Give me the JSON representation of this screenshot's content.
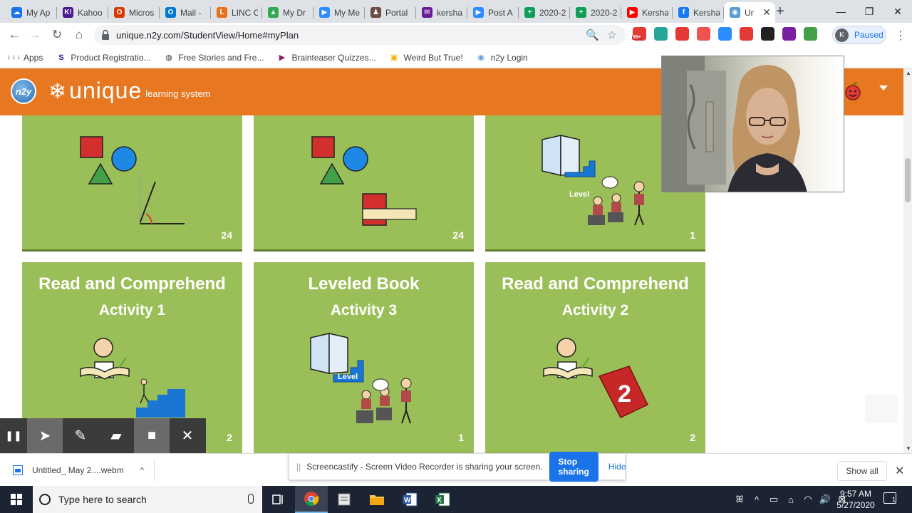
{
  "browser": {
    "tabs": [
      {
        "label": "My Ap",
        "color": "#1a73e8",
        "glyph": "☁"
      },
      {
        "label": "Kahoo",
        "color": "#46178f",
        "glyph": "K!"
      },
      {
        "label": "Micros",
        "color": "#d83b01",
        "glyph": "O"
      },
      {
        "label": "Mail -",
        "color": "#0078d4",
        "glyph": "O"
      },
      {
        "label": "LINC C",
        "color": "#e8711a",
        "glyph": "L"
      },
      {
        "label": "My Dr",
        "color": "#34a853",
        "glyph": "▲"
      },
      {
        "label": "My Me",
        "color": "#2d8cff",
        "glyph": "▶"
      },
      {
        "label": "Portal",
        "color": "#6d4c41",
        "glyph": "♟"
      },
      {
        "label": "kersha",
        "color": "#6a1b9a",
        "glyph": "✉"
      },
      {
        "label": "Post A",
        "color": "#2d8cff",
        "glyph": "▶"
      },
      {
        "label": "2020-2",
        "color": "#0f9d58",
        "glyph": "+"
      },
      {
        "label": "2020-2",
        "color": "#0f9d58",
        "glyph": "+"
      },
      {
        "label": "Kersha",
        "color": "#ff0000",
        "glyph": "▶"
      },
      {
        "label": "Kersha",
        "color": "#1877f2",
        "glyph": "f"
      },
      {
        "label": "Ur",
        "color": "#5b9bd5",
        "glyph": "◉",
        "active": true
      }
    ],
    "new_tab": "+",
    "window_controls": {
      "minimize": "—",
      "maximize": "❐",
      "close": "✕"
    },
    "nav": {
      "back": "←",
      "forward": "→",
      "reload": "↻",
      "home": "⌂"
    },
    "url": "unique.n2y.com/StudentView/Home#myPlan",
    "zoom_icon": "🔍",
    "star_icon": "☆",
    "extensions": [
      {
        "name": "ext-mail-icon",
        "color": "#e53935",
        "badge": "99+"
      },
      {
        "name": "ext-screenshot-icon",
        "color": "#26a69a"
      },
      {
        "name": "ext-record-icon",
        "color": "#e53935"
      },
      {
        "name": "ext-grammar-icon",
        "color": "#ef5350"
      },
      {
        "name": "ext-zoom-icon",
        "color": "#2d8cff"
      },
      {
        "name": "ext-yab-icon",
        "color": "#e53935"
      },
      {
        "name": "ext-qr-icon",
        "color": "#212121"
      },
      {
        "name": "ext-colorwheel-icon",
        "color": "#7b1fa2"
      },
      {
        "name": "ext-screencastify-icon",
        "color": "#43a047"
      }
    ],
    "profile": {
      "initial": "K",
      "status": "Paused"
    },
    "bookmarks": [
      {
        "label": "Apps",
        "icon": "apps-grid-icon"
      },
      {
        "label": "Product Registratio...",
        "icon": "s-logo-icon"
      },
      {
        "label": "Free Stories and Fre...",
        "icon": "globe-icon"
      },
      {
        "label": "Brainteaser Quizzes...",
        "icon": "brainteaser-icon"
      },
      {
        "label": "Weird But True!",
        "icon": "natgeo-icon"
      },
      {
        "label": "n2y Login",
        "icon": "n2y-icon"
      }
    ]
  },
  "site": {
    "logo_text": "n2y",
    "brand_main": "unique",
    "brand_sub": "learning system"
  },
  "cards": [
    {
      "title": "",
      "subtitle": "",
      "count": "24",
      "art": "shapes-angle"
    },
    {
      "title": "",
      "subtitle": "",
      "count": "24",
      "art": "shapes-ruler"
    },
    {
      "title": "",
      "subtitle": "",
      "count": "1",
      "art": "leveled-book"
    },
    {
      "title": "Read and Comprehend",
      "subtitle": "Activity 1",
      "count": "2",
      "art": "reader-stairs"
    },
    {
      "title": "Leveled Book",
      "subtitle": "Activity 3",
      "count": "1",
      "art": "leveled-book"
    },
    {
      "title": "Read and Comprehend",
      "subtitle": "Activity 2",
      "count": "2",
      "art": "reader-book2"
    }
  ],
  "art_labels": {
    "level": "Level",
    "book_number": "2"
  },
  "screencastify": {
    "tools": [
      {
        "name": "pause-icon",
        "glyph": "❚❚"
      },
      {
        "name": "cursor-icon",
        "glyph": "➤"
      },
      {
        "name": "pen-icon",
        "glyph": "✎"
      },
      {
        "name": "highlighter-icon",
        "glyph": "▰"
      },
      {
        "name": "camera-icon",
        "glyph": "■"
      },
      {
        "name": "close-icon",
        "glyph": "✕"
      }
    ]
  },
  "share_notice": {
    "grip": "||",
    "message": "Screencastify - Screen Video Recorder is sharing your screen.",
    "stop_label": "Stop sharing",
    "hide_label": "Hide"
  },
  "downloads": {
    "file": "Untitled_ May 2....webm",
    "chevron": "^",
    "show_all": "Show all",
    "close": "✕"
  },
  "taskbar": {
    "search_placeholder": "Type here to search",
    "time": "9:57 AM",
    "date": "5/27/2020",
    "notification_count": "1",
    "tray_icons": [
      "ꕤ",
      "^",
      "▭",
      "⌂",
      "◠",
      "🔊",
      "⊠"
    ]
  }
}
